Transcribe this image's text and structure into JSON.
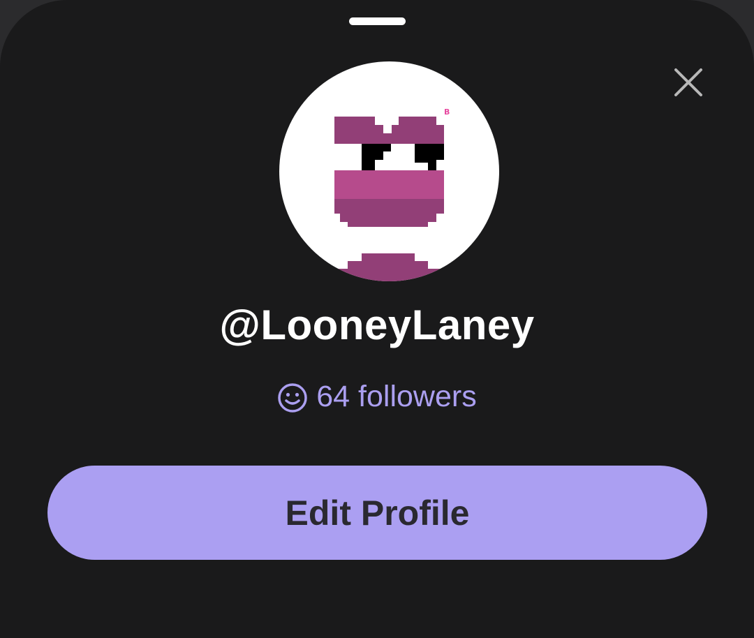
{
  "profile": {
    "username": "@LooneyLaney",
    "followers_text": "64 followers",
    "avatar_icon": "pixel-face-avatar"
  },
  "actions": {
    "edit_profile_label": "Edit Profile",
    "close_icon": "close-icon"
  },
  "colors": {
    "sheet_background": "#1a1a1b",
    "accent": "#ab9ff2",
    "followers_text": "#ab9ff0",
    "avatar_magenta": "#b64b8c",
    "avatar_dark_magenta": "#923f77"
  }
}
